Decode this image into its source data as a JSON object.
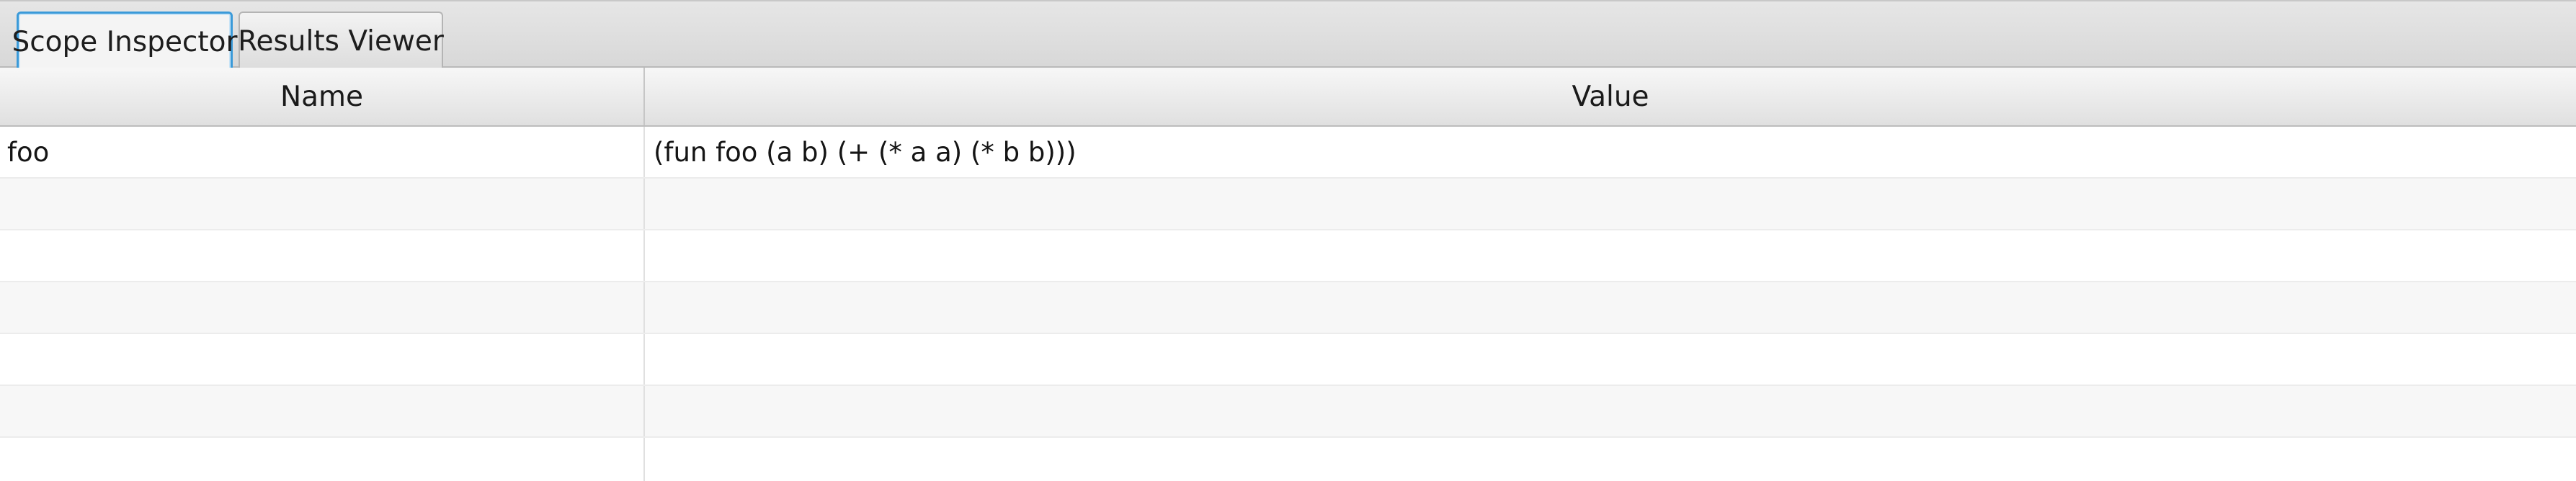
{
  "tabs": [
    {
      "label": "Scope Inspector",
      "selected": true
    },
    {
      "label": "Results Viewer",
      "selected": false
    }
  ],
  "table": {
    "columns": {
      "name": "Name",
      "value": "Value"
    },
    "rows": [
      {
        "name": "foo",
        "value": "(fun foo (a b) (+ (* a a) (* b b)))"
      },
      {
        "name": "",
        "value": ""
      },
      {
        "name": "",
        "value": ""
      },
      {
        "name": "",
        "value": ""
      },
      {
        "name": "",
        "value": ""
      },
      {
        "name": "",
        "value": ""
      },
      {
        "name": "",
        "value": ""
      }
    ]
  },
  "colors": {
    "selected_tab_accent": "#3a9ad9",
    "row_alt": "#f7f7f7",
    "header_bg": "#e0e0e0"
  }
}
